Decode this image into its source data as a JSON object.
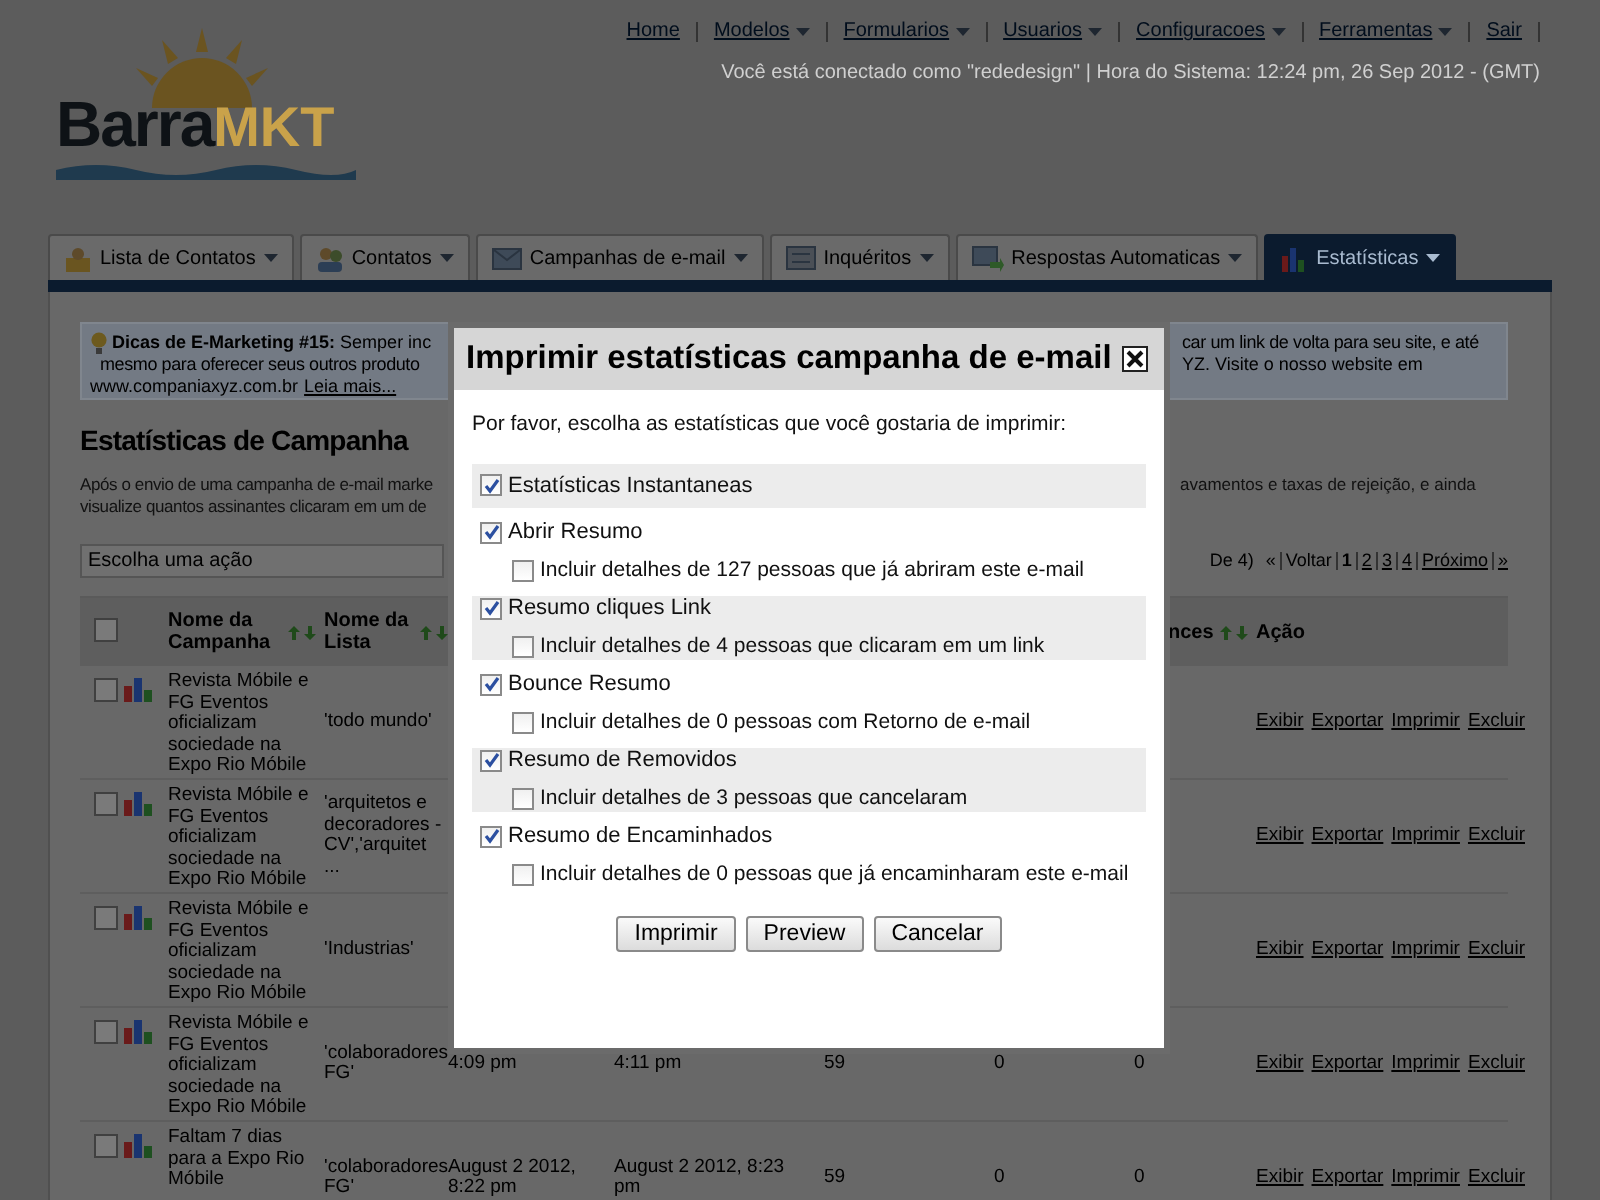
{
  "nav": {
    "items": [
      {
        "label": "Home",
        "dropdown": false
      },
      {
        "label": "Modelos",
        "dropdown": true
      },
      {
        "label": "Formularios",
        "dropdown": true
      },
      {
        "label": "Usuarios",
        "dropdown": true
      },
      {
        "label": "Configuracoes",
        "dropdown": true
      },
      {
        "label": "Ferramentas",
        "dropdown": true
      },
      {
        "label": "Sair",
        "dropdown": false
      }
    ],
    "session_info": "Você está conectado como \"rededesign\" | Hora do Sistema: 12:24 pm, 26 Sep 2012 - (GMT)"
  },
  "logo": {
    "text_1": "Barra",
    "text_2": "MKT"
  },
  "tabs": [
    {
      "label": "Lista de Contatos",
      "kind": "contacts-list",
      "selected": false
    },
    {
      "label": "Contatos",
      "kind": "contacts",
      "selected": false
    },
    {
      "label": "Campanhas de e-mail",
      "kind": "campaigns",
      "selected": false
    },
    {
      "label": "Inquéritos",
      "kind": "inquiries",
      "selected": false
    },
    {
      "label": "Respostas Automaticas",
      "kind": "autoresponders",
      "selected": false
    },
    {
      "label": "Estatísticas",
      "kind": "statistics",
      "selected": true
    }
  ],
  "tip": {
    "title": "Dicas de E-Marketing #15:",
    "line_1_left": "Semper inc",
    "line_1_right": "car um link de volta para seu site, e até",
    "line_2_left": "mesmo para oferecer seus outros produto",
    "line_2_right": "YZ. Visite o nosso website em",
    "line_3": "www.companiaxyz.com.br",
    "link": "Leia mais..."
  },
  "page_title": "Estatísticas de Campanha",
  "description": {
    "line_1_left": "Após o envio de uma campanha de e-mail marke",
    "line_1_right": "avamentos e taxas de rejeição, e ainda",
    "line_2_left": "visualize quantos assinantes clicaram em um de"
  },
  "action_select": {
    "placeholder": "Escolha uma ação"
  },
  "pagination": {
    "summary": "De 4)",
    "first": "«",
    "previous": "Voltar",
    "pages": [
      {
        "label": "1",
        "selected": true
      },
      {
        "label": "2",
        "selected": false
      },
      {
        "label": "3",
        "selected": false
      },
      {
        "label": "4",
        "selected": false
      }
    ],
    "next": "Próximo",
    "last": "»"
  },
  "table": {
    "header_checked": false,
    "columns": {
      "campaign": "Nome da Campanha",
      "list": "Nome da Lista",
      "column_9": "nces",
      "action": "Ação"
    },
    "rows": [
      {
        "checked": false,
        "campaign": "Revista Móbile e FG Eventos oficializam sociedade na Expo Rio Móbile",
        "list": "'todo mundo'",
        "actions": [
          "Exibir",
          "Exportar",
          "Imprimir",
          "Excluir"
        ]
      },
      {
        "checked": false,
        "campaign": "Revista Móbile e FG Eventos oficializam sociedade na Expo Rio Móbile",
        "list": "'arquitetos e decoradores - CV','arquitet ...",
        "actions": [
          "Exibir",
          "Exportar",
          "Imprimir",
          "Excluir"
        ]
      },
      {
        "checked": false,
        "campaign": "Revista Móbile e FG Eventos oficializam sociedade na Expo Rio Móbile",
        "list": "'Industrias'",
        "actions": [
          "Exibir",
          "Exportar",
          "Imprimir",
          "Excluir"
        ]
      },
      {
        "checked": false,
        "campaign": "Revista Móbile e FG Eventos oficializam sociedade na Expo Rio Móbile",
        "list": "'colaboradores FG'",
        "column_5": "4:09 pm",
        "column_6": "4:11 pm",
        "column_7": "59",
        "column_8": "0",
        "column_9": "0",
        "actions": [
          "Exibir",
          "Exportar",
          "Imprimir",
          "Excluir"
        ]
      },
      {
        "checked": false,
        "campaign": "Faltam 7 dias para a Expo Rio Móbile",
        "list": "'colaboradores FG'",
        "column_5": "August 2 2012, 8:22 pm",
        "column_6": "August 2 2012, 8:23 pm",
        "column_7": "59",
        "column_8": "0",
        "column_9": "0",
        "actions": [
          "Exibir",
          "Exportar",
          "Imprimir",
          "Excluir"
        ]
      }
    ]
  },
  "modal": {
    "title": "Imprimir estatísticas campanha de e-mail",
    "prompt": "Por favor, escolha as estatísticas que você gostaria de imprimir:",
    "options": [
      {
        "label": "Estatísticas Instantaneas",
        "checked": true
      },
      {
        "label": "Abrir Resumo",
        "checked": true,
        "detail": {
          "label": "Incluir detalhes de 127 pessoas que já abriram este e-mail",
          "checked": false
        }
      },
      {
        "label": "Resumo cliques Link",
        "checked": true,
        "detail": {
          "label": "Incluir detalhes de 4 pessoas que clicaram em um link",
          "checked": false
        }
      },
      {
        "label": "Bounce Resumo",
        "checked": true,
        "detail": {
          "label": "Incluir detalhes de 0 pessoas com Retorno de e-mail",
          "checked": false
        }
      },
      {
        "label": "Resumo de Removidos",
        "checked": true,
        "detail": {
          "label": "Incluir detalhes de 3 pessoas que cancelaram",
          "checked": false
        }
      },
      {
        "label": "Resumo de Encaminhados",
        "checked": true,
        "detail": {
          "label": "Incluir detalhes de 0 pessoas que já encaminharam este e-mail",
          "checked": false
        }
      }
    ],
    "buttons": [
      "Imprimir",
      "Preview",
      "Cancelar"
    ]
  }
}
